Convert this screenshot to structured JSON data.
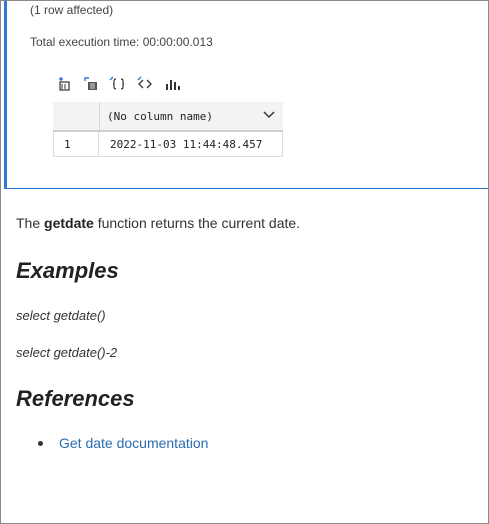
{
  "output": {
    "rows_affected": "(1 row affected)",
    "execution_time": "Total execution time: 00:00:00.013"
  },
  "toolbar": {
    "buttons": [
      {
        "name": "save-as-csv-icon"
      },
      {
        "name": "save-as-excel-icon"
      },
      {
        "name": "save-as-json-icon"
      },
      {
        "name": "save-as-xml-icon"
      },
      {
        "name": "chart-icon"
      }
    ]
  },
  "grid": {
    "column_header": "(No column name)",
    "rows": [
      {
        "num": "1",
        "value": "2022-11-03 11:44:48.457"
      }
    ]
  },
  "markdown": {
    "desc_prefix": "The ",
    "desc_bold": "getdate",
    "desc_suffix": " function returns the current date.",
    "examples_heading": "Examples",
    "example1": "select getdate()",
    "example2": "select getdate()-2",
    "references_heading": "References",
    "reference_link": "Get date documentation"
  },
  "colors": {
    "accent": "#2f7bd3",
    "link": "#2b6cb0"
  }
}
